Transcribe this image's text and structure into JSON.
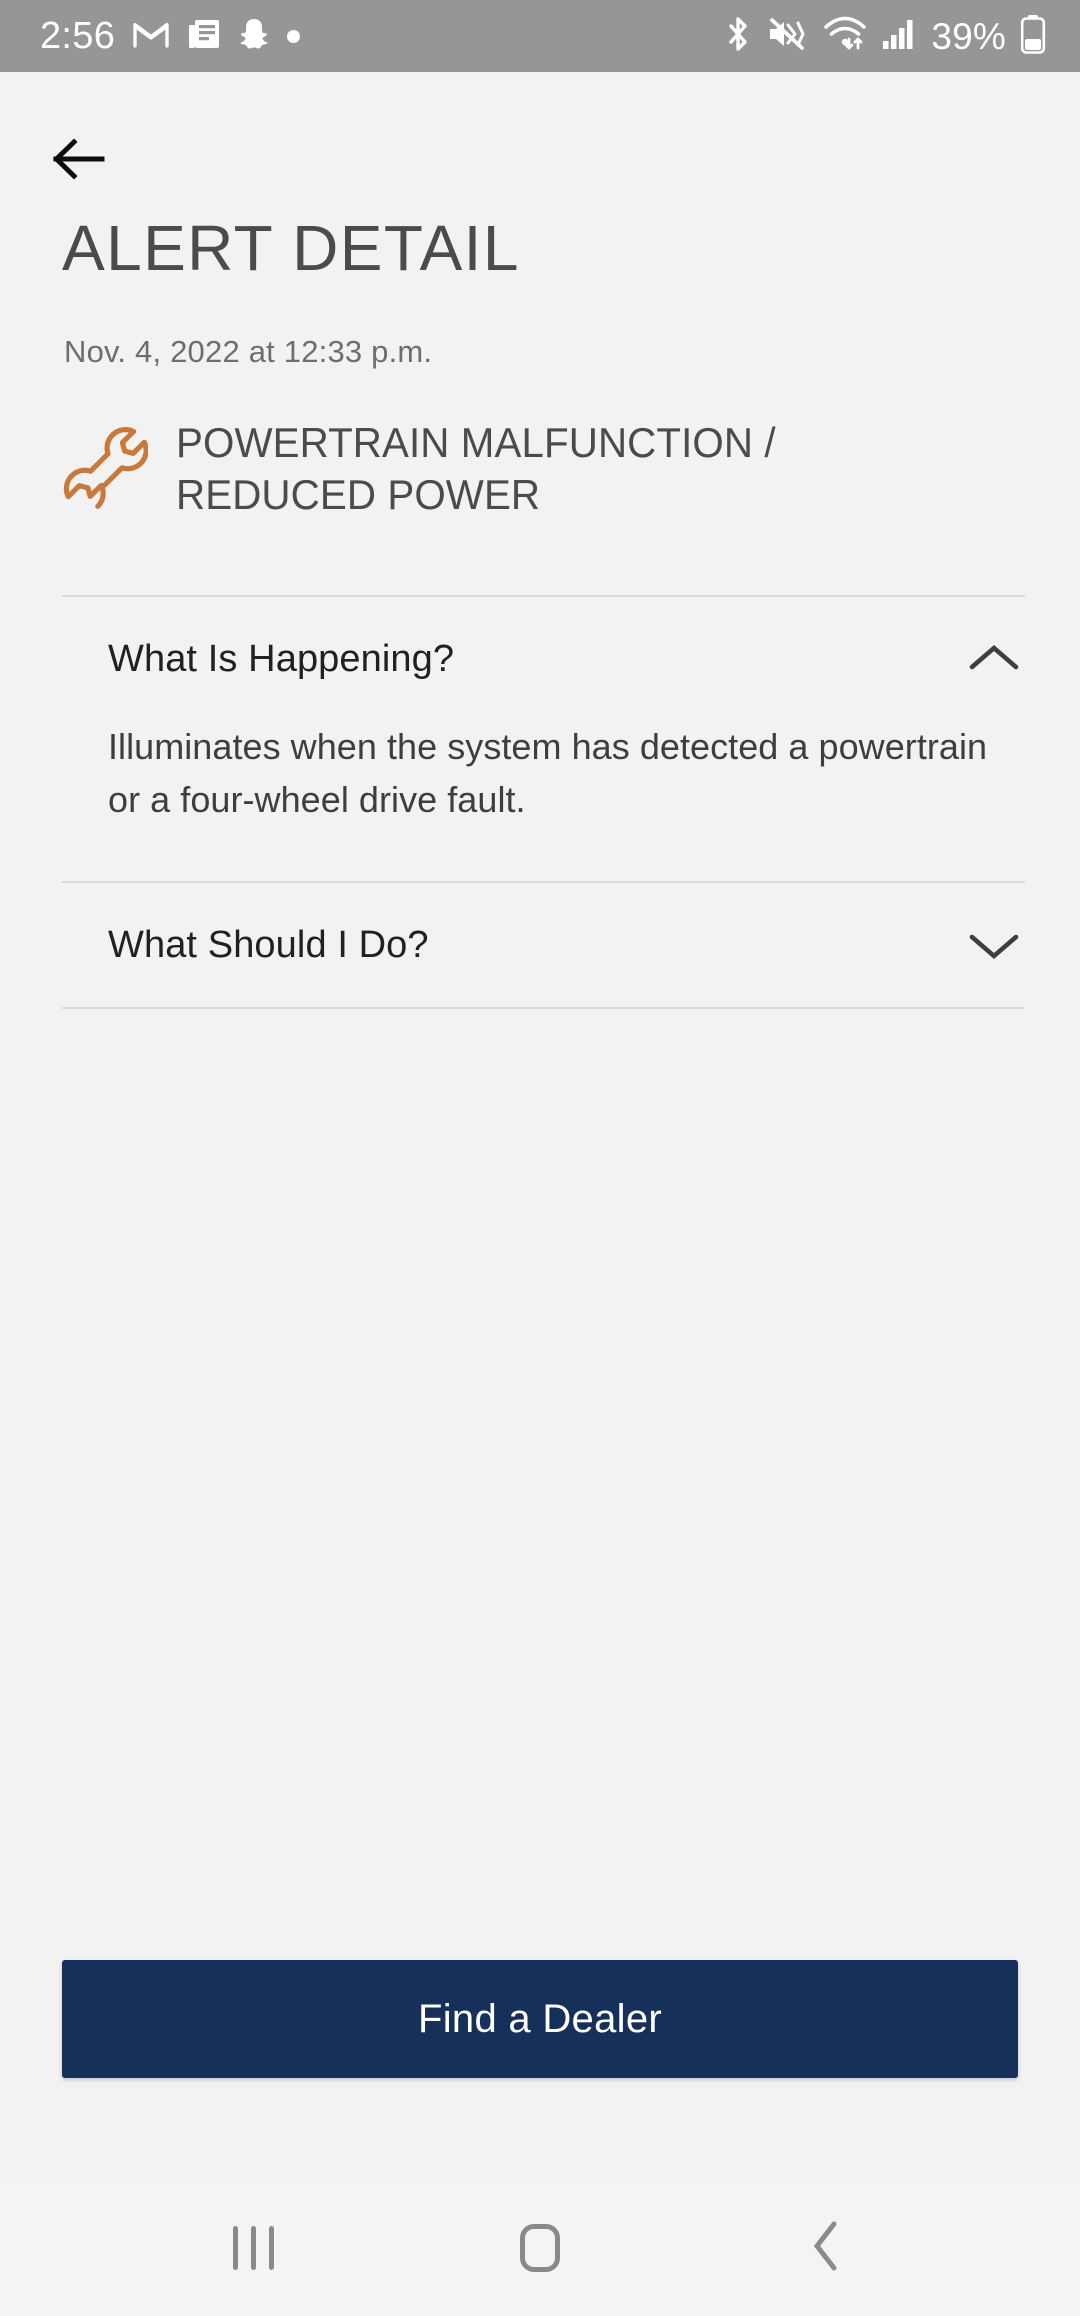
{
  "status_bar": {
    "clock": "2:56",
    "battery_percent": "39%",
    "left_icons": [
      "gmail-icon",
      "news-feed-icon",
      "snapchat-icon",
      "dot-indicator-icon"
    ],
    "right_icons": [
      "bluetooth-icon",
      "mute-vibrate-icon",
      "wifi-icon",
      "cellular-signal-icon",
      "battery-icon"
    ],
    "background_color": "#969696",
    "foreground_color": "#ffffff"
  },
  "header": {
    "back_icon": "arrow-left-icon",
    "title": "ALERT DETAIL"
  },
  "alert": {
    "timestamp": "Nov. 4, 2022 at 12:33 p.m.",
    "icon": "wrench-icon",
    "icon_color": "#c8793c",
    "title": "POWERTRAIN MALFUNCTION / REDUCED POWER"
  },
  "sections": [
    {
      "label": "What Is Happening?",
      "expanded": true,
      "chevron": "chevron-up-icon",
      "body": "Illuminates when the system has detected a powertrain or a four-wheel drive fault."
    },
    {
      "label": "What Should I Do?",
      "expanded": false,
      "chevron": "chevron-down-icon",
      "body": ""
    }
  ],
  "cta": {
    "label": "Find a Dealer",
    "color": "#16305a",
    "text_color": "#ffffff"
  },
  "nav_bar": {
    "recents_icon": "recents-bars-icon",
    "home_icon": "home-square-icon",
    "back_icon": "chevron-left-icon",
    "color": "#8a8a8a"
  },
  "theme": {
    "page_background": "#f2f2f2",
    "divider_color": "#dadada",
    "title_color": "#4b4b4b",
    "body_text_color": "#3e3e3e"
  }
}
